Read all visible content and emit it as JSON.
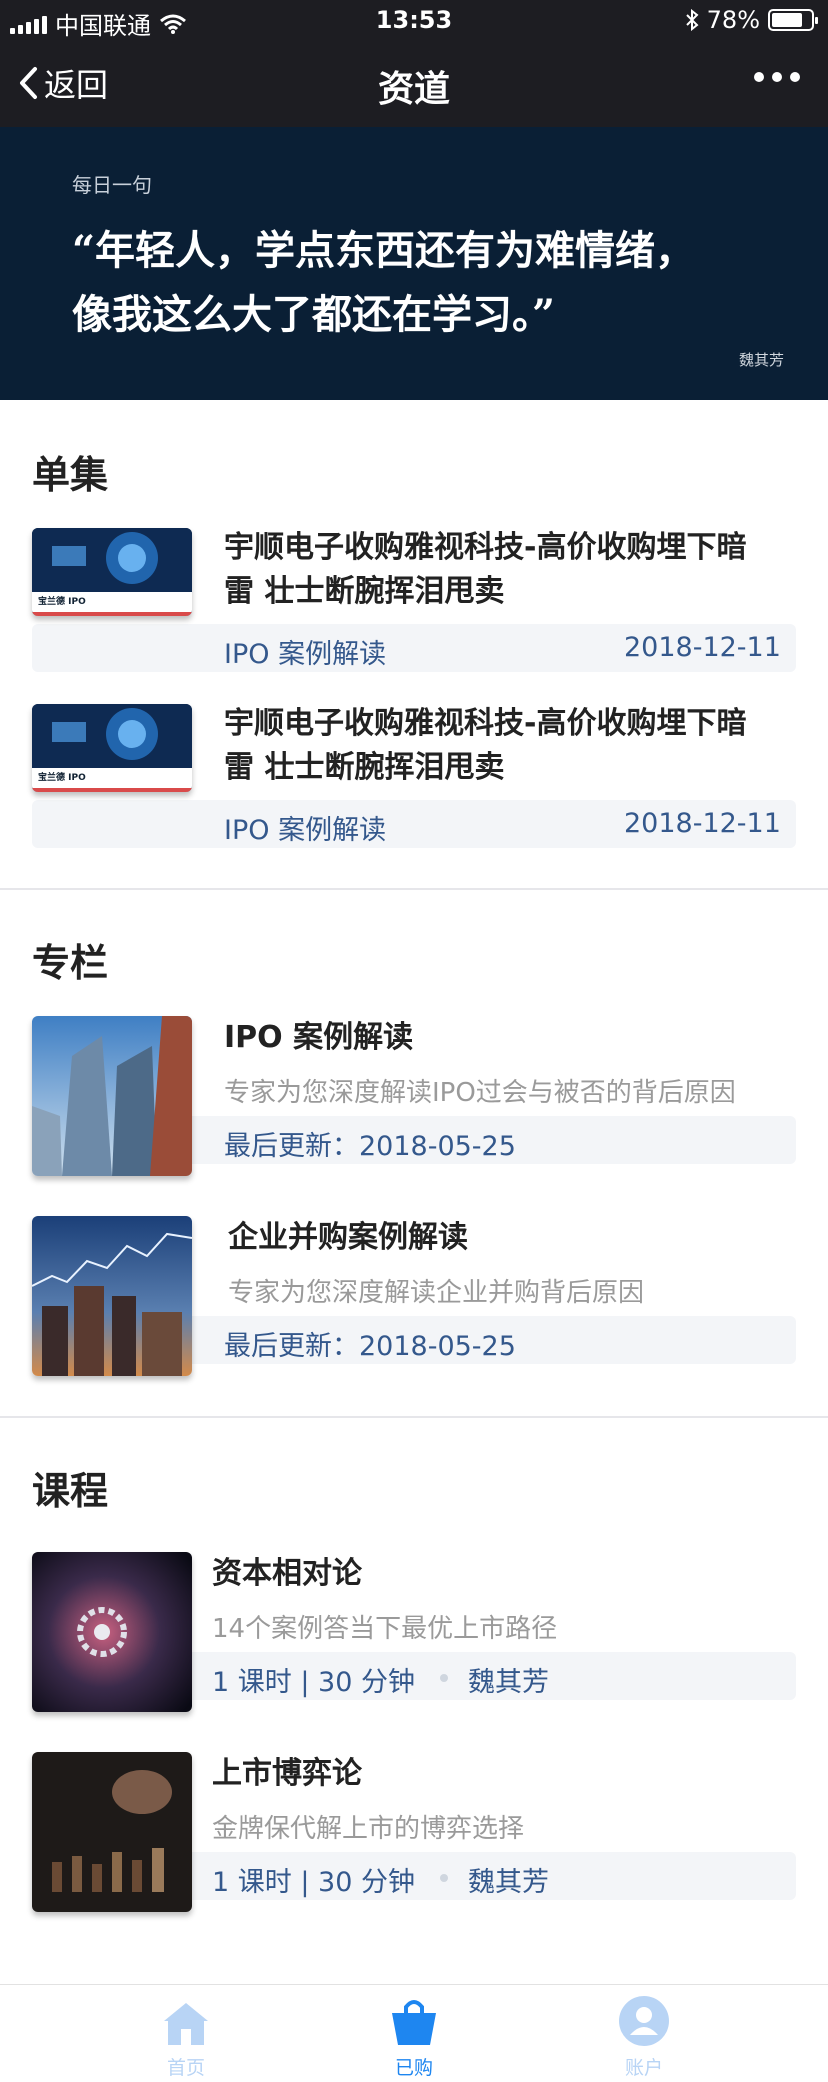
{
  "status_bar": {
    "carrier": "中国联通",
    "time": "13:53",
    "battery_percent": "78%",
    "battery_level": 0.78
  },
  "nav": {
    "back_label": "返回",
    "title": "资道"
  },
  "banner": {
    "label": "每日一句",
    "quote_line1": "“年轻人，学点东西还有为难情绪，",
    "quote_line2": "像我这么大了都还在学习。”",
    "author": "魏其芳"
  },
  "episodes": {
    "heading": "单集",
    "items": [
      {
        "title_line1": "宇顺电子收购雅视科技-高价收购埋下暗",
        "title_line2": "雷 壮士断腕挥泪甩卖",
        "category": "IPO 案例解读",
        "date": "2018-12-11",
        "thumb_text": "宝兰德 IPO"
      },
      {
        "title_line1": "宇顺电子收购雅视科技-高价收购埋下暗",
        "title_line2": "雷 壮士断腕挥泪甩卖",
        "category": "IPO 案例解读",
        "date": "2018-12-11",
        "thumb_text": "宝兰德 IPO"
      }
    ]
  },
  "columns": {
    "heading": "专栏",
    "items": [
      {
        "title": "IPO 案例解读",
        "desc": "专家为您深度解读IPO过会与被否的背后原因",
        "updated": "最后更新：2018-05-25"
      },
      {
        "title": "企业并购案例解读",
        "desc": "专家为您深度解读企业并购背后原因",
        "updated": "最后更新：2018-05-25"
      }
    ]
  },
  "courses": {
    "heading": "课程",
    "items": [
      {
        "title": "资本相对论",
        "desc": "14个案例答当下最优上市路径",
        "lessons": "1 课时 | 30 分钟",
        "teacher": "魏其芳"
      },
      {
        "title": "上市博弈论",
        "desc": "金牌保代解上市的博弈选择",
        "lessons": "1 课时 | 30 分钟",
        "teacher": "魏其芳"
      }
    ]
  },
  "tabbar": {
    "home": "首页",
    "purchased": "已购",
    "account": "账户",
    "active_color": "#1e86f0",
    "inactive_color": "#b8d4f5"
  }
}
